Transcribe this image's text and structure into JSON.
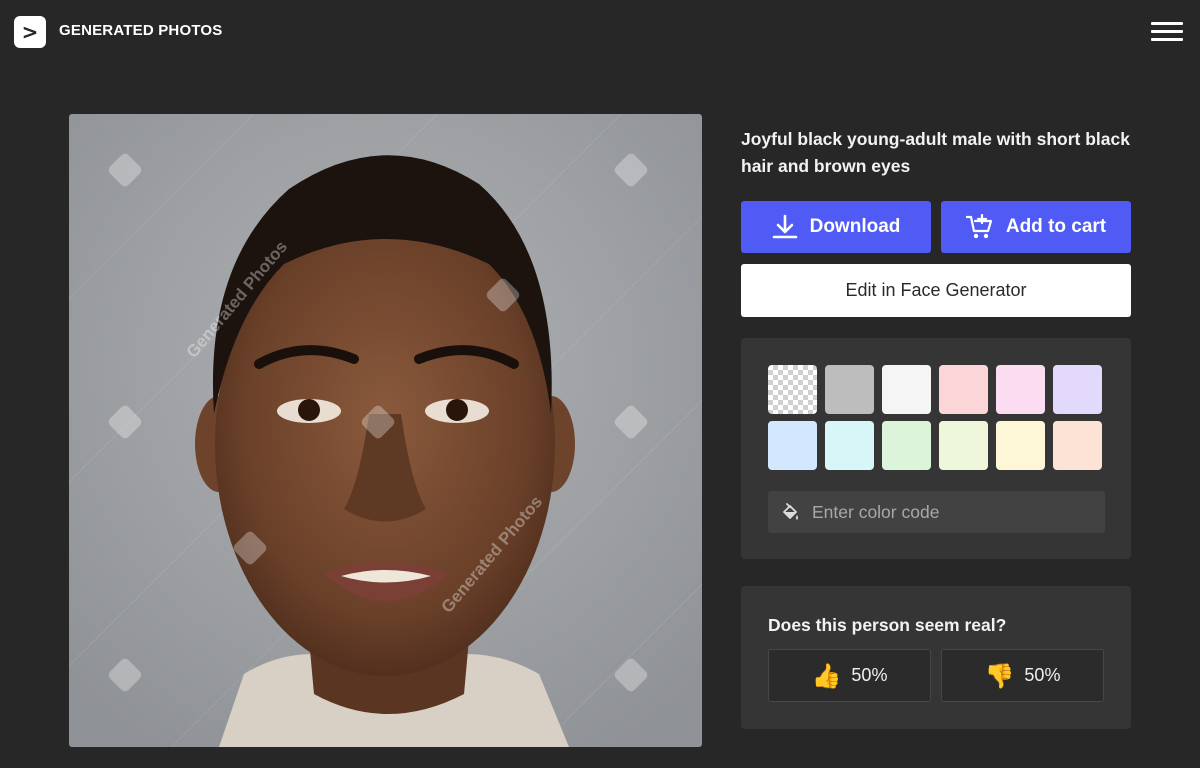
{
  "header": {
    "logo_glyph": ">",
    "logo_text": "GENERATED PHOTOS",
    "menu_icon": "hamburger-menu-icon"
  },
  "photo": {
    "alt": "Joyful black young-adult male with short black hair and brown eyes",
    "watermark_text": "Generated Photos",
    "background_color": "#9ea1a4"
  },
  "description": "Joyful black young-adult male with short black hair and brown eyes",
  "actions": {
    "download_label": "Download",
    "download_icon": "download-icon",
    "add_to_cart_label": "Add to cart",
    "add_to_cart_icon": "cart-plus-icon",
    "edit_label": "Edit in Face Generator",
    "accent_color": "#4f5bf4"
  },
  "backgrounds": {
    "swatches": [
      {
        "name": "transparent",
        "color": "transparent"
      },
      {
        "name": "gray",
        "color": "#bdbdbd"
      },
      {
        "name": "white",
        "color": "#f5f5f5"
      },
      {
        "name": "pink",
        "color": "#fbd5d7"
      },
      {
        "name": "lavender-pink",
        "color": "#fbdcf0"
      },
      {
        "name": "lavender",
        "color": "#e3d9fc"
      },
      {
        "name": "light-blue",
        "color": "#d3e7fe"
      },
      {
        "name": "light-cyan",
        "color": "#d8f5f7"
      },
      {
        "name": "light-green",
        "color": "#dcf4d9"
      },
      {
        "name": "light-lime",
        "color": "#eef7db"
      },
      {
        "name": "light-yellow",
        "color": "#fdf6d7"
      },
      {
        "name": "peach",
        "color": "#fde3d6"
      }
    ],
    "color_input_placeholder": "Enter color code",
    "color_input_icon": "paint-bucket-icon"
  },
  "realness": {
    "question": "Does this person seem real?",
    "yes_icon": "thumbs-up-icon",
    "yes_percent": "50%",
    "no_icon": "thumbs-down-icon",
    "no_percent": "50%"
  }
}
